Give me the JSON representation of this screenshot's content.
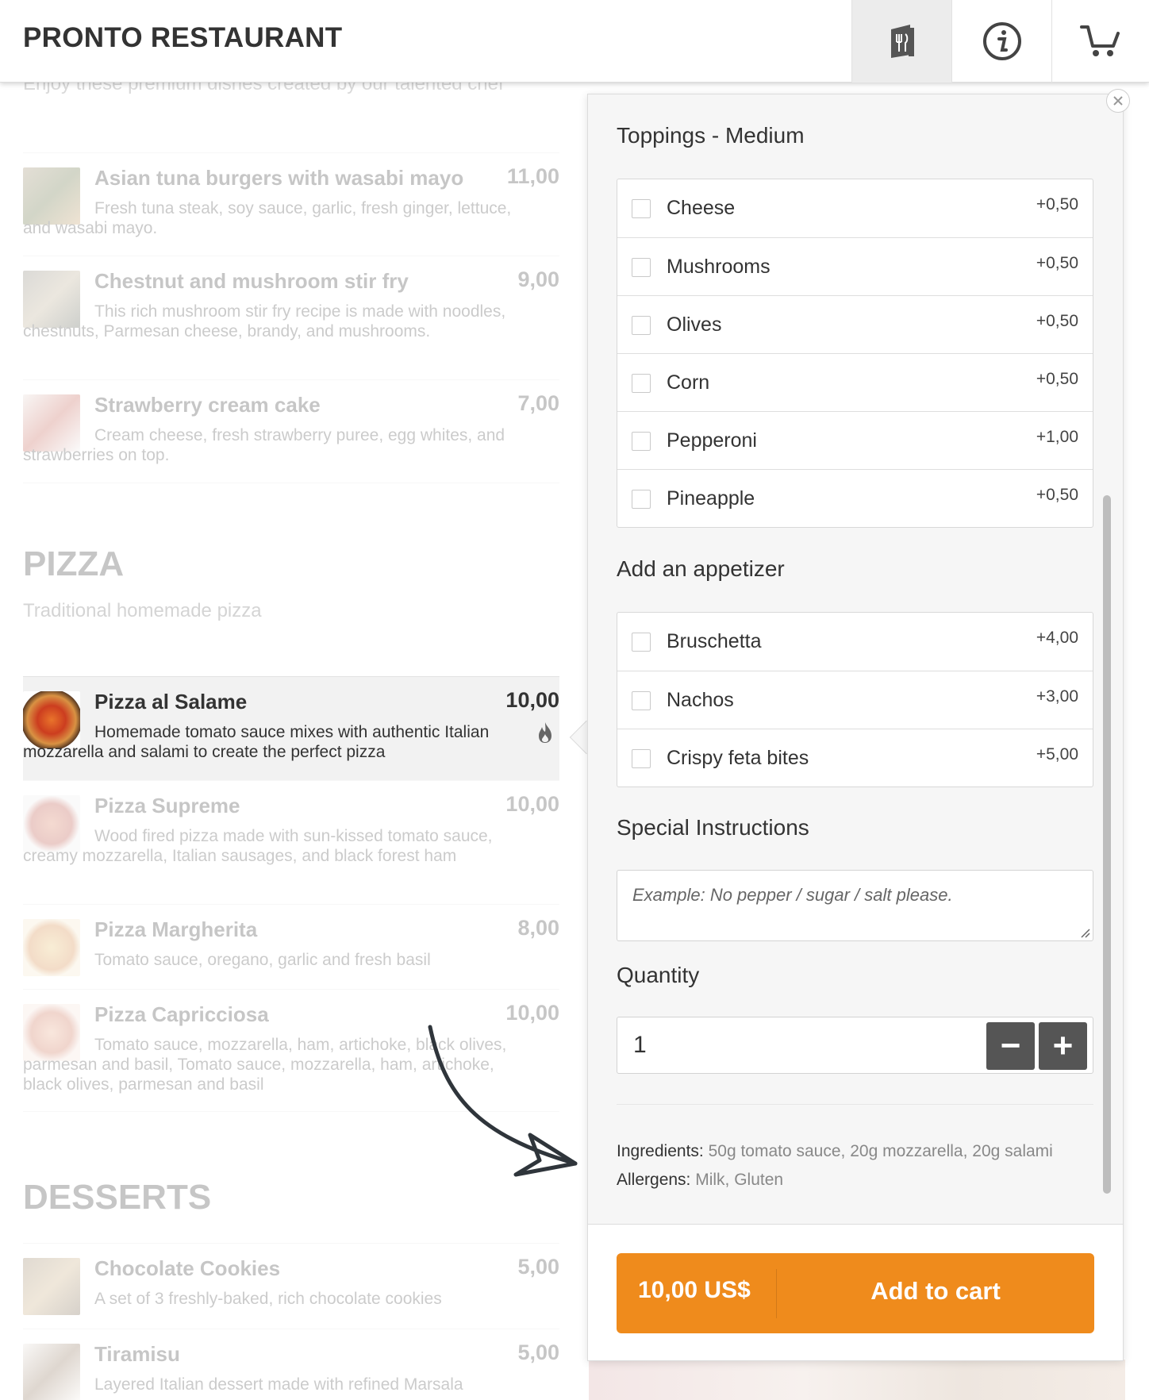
{
  "header": {
    "brand": "PRONTO RESTAURANT",
    "icons": [
      "menu-book-icon",
      "info-icon",
      "cart-icon"
    ]
  },
  "menu": {
    "featured_subtitle": "Enjoy these premium dishes created by our talented chef",
    "featured_items": [
      {
        "name": "Asian tuna burgers with wasabi mayo",
        "price": "11,00",
        "desc": "Fresh tuna steak, soy sauce, garlic, fresh ginger, lettuce, and wasabi mayo."
      },
      {
        "name": "Chestnut and mushroom stir fry",
        "price": "9,00",
        "desc": "This rich mushroom stir fry recipe is made with noodles, chestnuts, Parmesan cheese, brandy, and mushrooms."
      },
      {
        "name": "Strawberry cream cake",
        "price": "7,00",
        "desc": "Cream cheese, fresh strawberry puree, egg whites, and strawberries on top."
      }
    ],
    "pizza": {
      "title": "PIZZA",
      "subtitle": "Traditional homemade pizza",
      "items": [
        {
          "name": "Pizza al Salame",
          "price": "10,00",
          "desc": "Homemade tomato sauce mixes with authentic Italian mozzarella and salami to create the perfect pizza"
        },
        {
          "name": "Pizza Supreme",
          "price": "10,00",
          "desc": "Wood fired pizza made with sun-kissed tomato sauce, creamy mozzarella, Italian sausages, and black forest ham"
        },
        {
          "name": "Pizza Margherita",
          "price": "8,00",
          "desc": "Tomato sauce, oregano, garlic and fresh basil"
        },
        {
          "name": "Pizza Capricciosa",
          "price": "10,00",
          "desc": "Tomato sauce, mozzarella, ham, artichoke, black olives, parmesan and basil, Tomato sauce, mozzarella, ham, artichoke, black olives, parmesan and basil"
        }
      ]
    },
    "desserts": {
      "title": "DESSERTS",
      "items": [
        {
          "name": "Chocolate Cookies",
          "price": "5,00",
          "desc": "A set of 3 freshly-baked, rich chocolate cookies"
        },
        {
          "name": "Tiramisu",
          "price": "5,00",
          "desc": "Layered Italian dessert made with refined Marsala"
        }
      ]
    }
  },
  "panel": {
    "toppings_title": "Toppings - Medium",
    "toppings": [
      {
        "label": "Cheese",
        "price": "+0,50"
      },
      {
        "label": "Mushrooms",
        "price": "+0,50"
      },
      {
        "label": "Olives",
        "price": "+0,50"
      },
      {
        "label": "Corn",
        "price": "+0,50"
      },
      {
        "label": "Pepperoni",
        "price": "+1,00"
      },
      {
        "label": "Pineapple",
        "price": "+0,50"
      }
    ],
    "appetizer_title": "Add an appetizer",
    "appetizers": [
      {
        "label": "Bruschetta",
        "price": "+4,00"
      },
      {
        "label": "Nachos",
        "price": "+3,00"
      },
      {
        "label": "Crispy feta bites",
        "price": "+5,00"
      }
    ],
    "instructions_title": "Special Instructions",
    "instructions_placeholder": "Example: No pepper / sugar / salt please.",
    "quantity_title": "Quantity",
    "quantity_value": "1",
    "minus": "−",
    "plus": "+",
    "ingredients_label": "Ingredients:",
    "ingredients_value": "50g tomato sauce, 20g mozzarella, 20g salami",
    "allergens_label": "Allergens:",
    "allergens_value": "Milk, Gluten",
    "total": "10,00 US$",
    "add_to_cart": "Add to cart"
  },
  "colors": {
    "accent": "#ef8b1c",
    "qty_button": "#555555"
  }
}
